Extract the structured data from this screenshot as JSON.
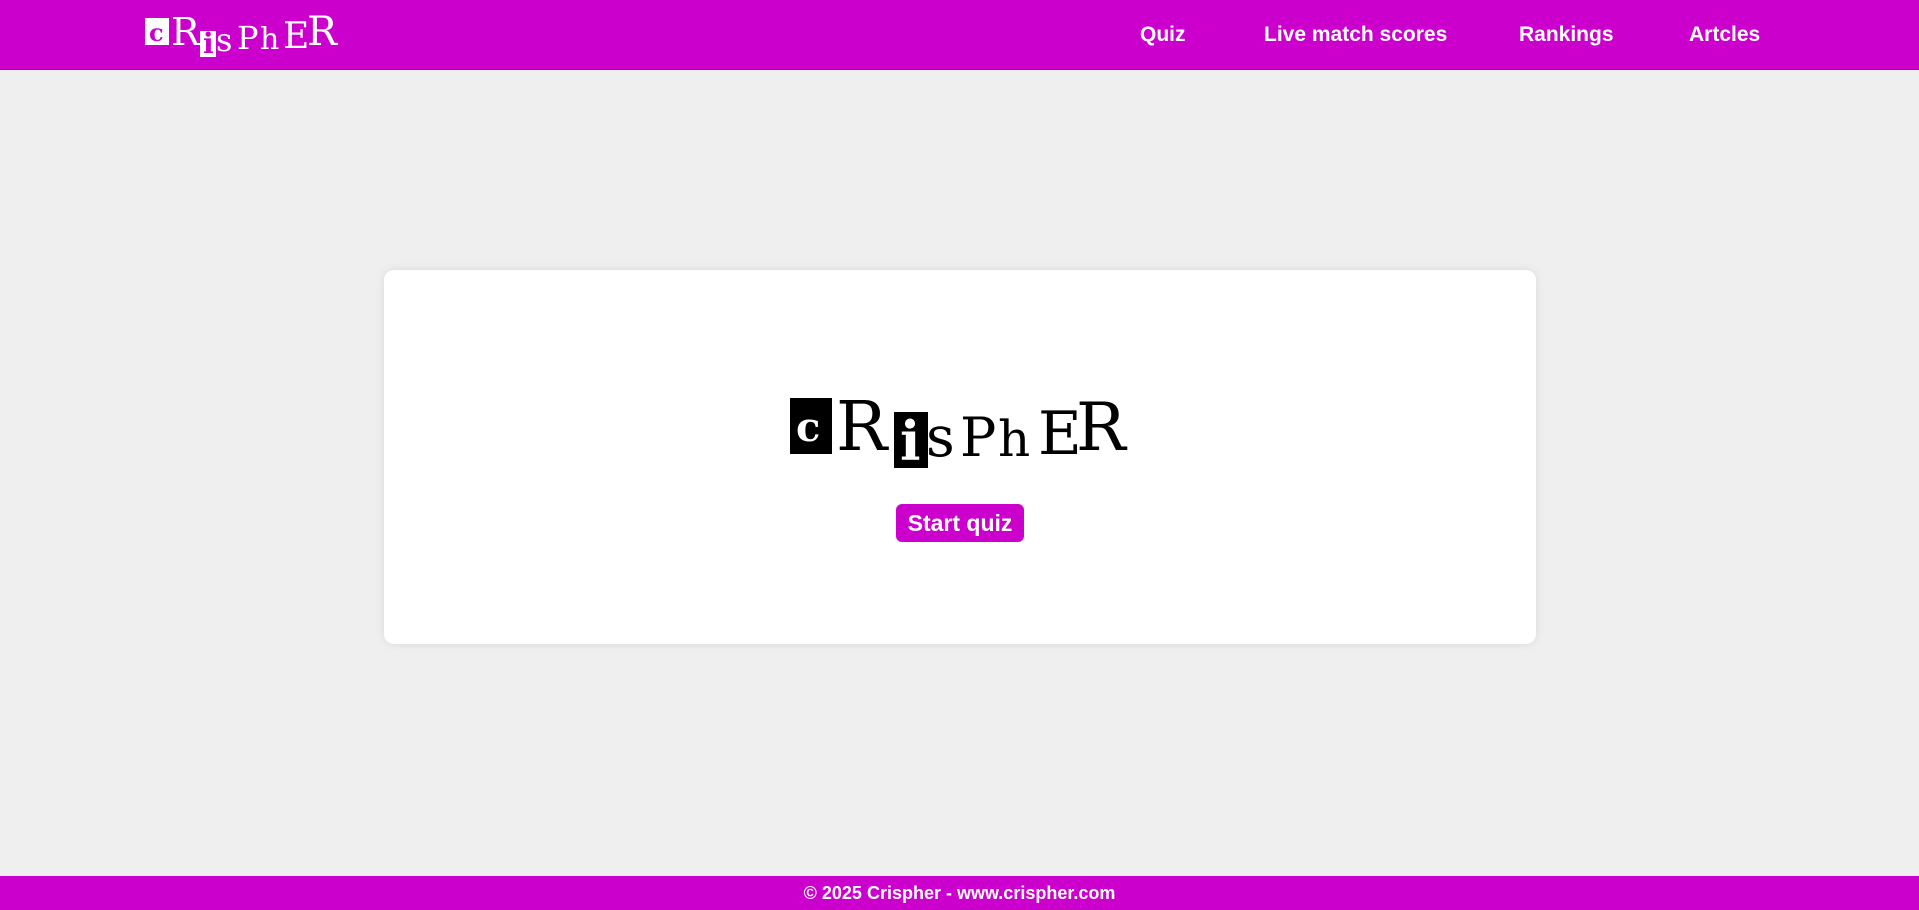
{
  "header": {
    "logo_text": "CRisPhER",
    "nav": [
      {
        "label": "Quiz"
      },
      {
        "label": "Live match scores"
      },
      {
        "label": "Rankings"
      },
      {
        "label": "Artcles"
      }
    ]
  },
  "main": {
    "card_logo_text": "CRisPhER",
    "start_button_label": "Start quiz"
  },
  "footer": {
    "copyright": "© 2025 Crispher - www.crispher.com"
  },
  "colors": {
    "brand": "#cc00cc",
    "background": "#efefef",
    "card": "#ffffff"
  }
}
